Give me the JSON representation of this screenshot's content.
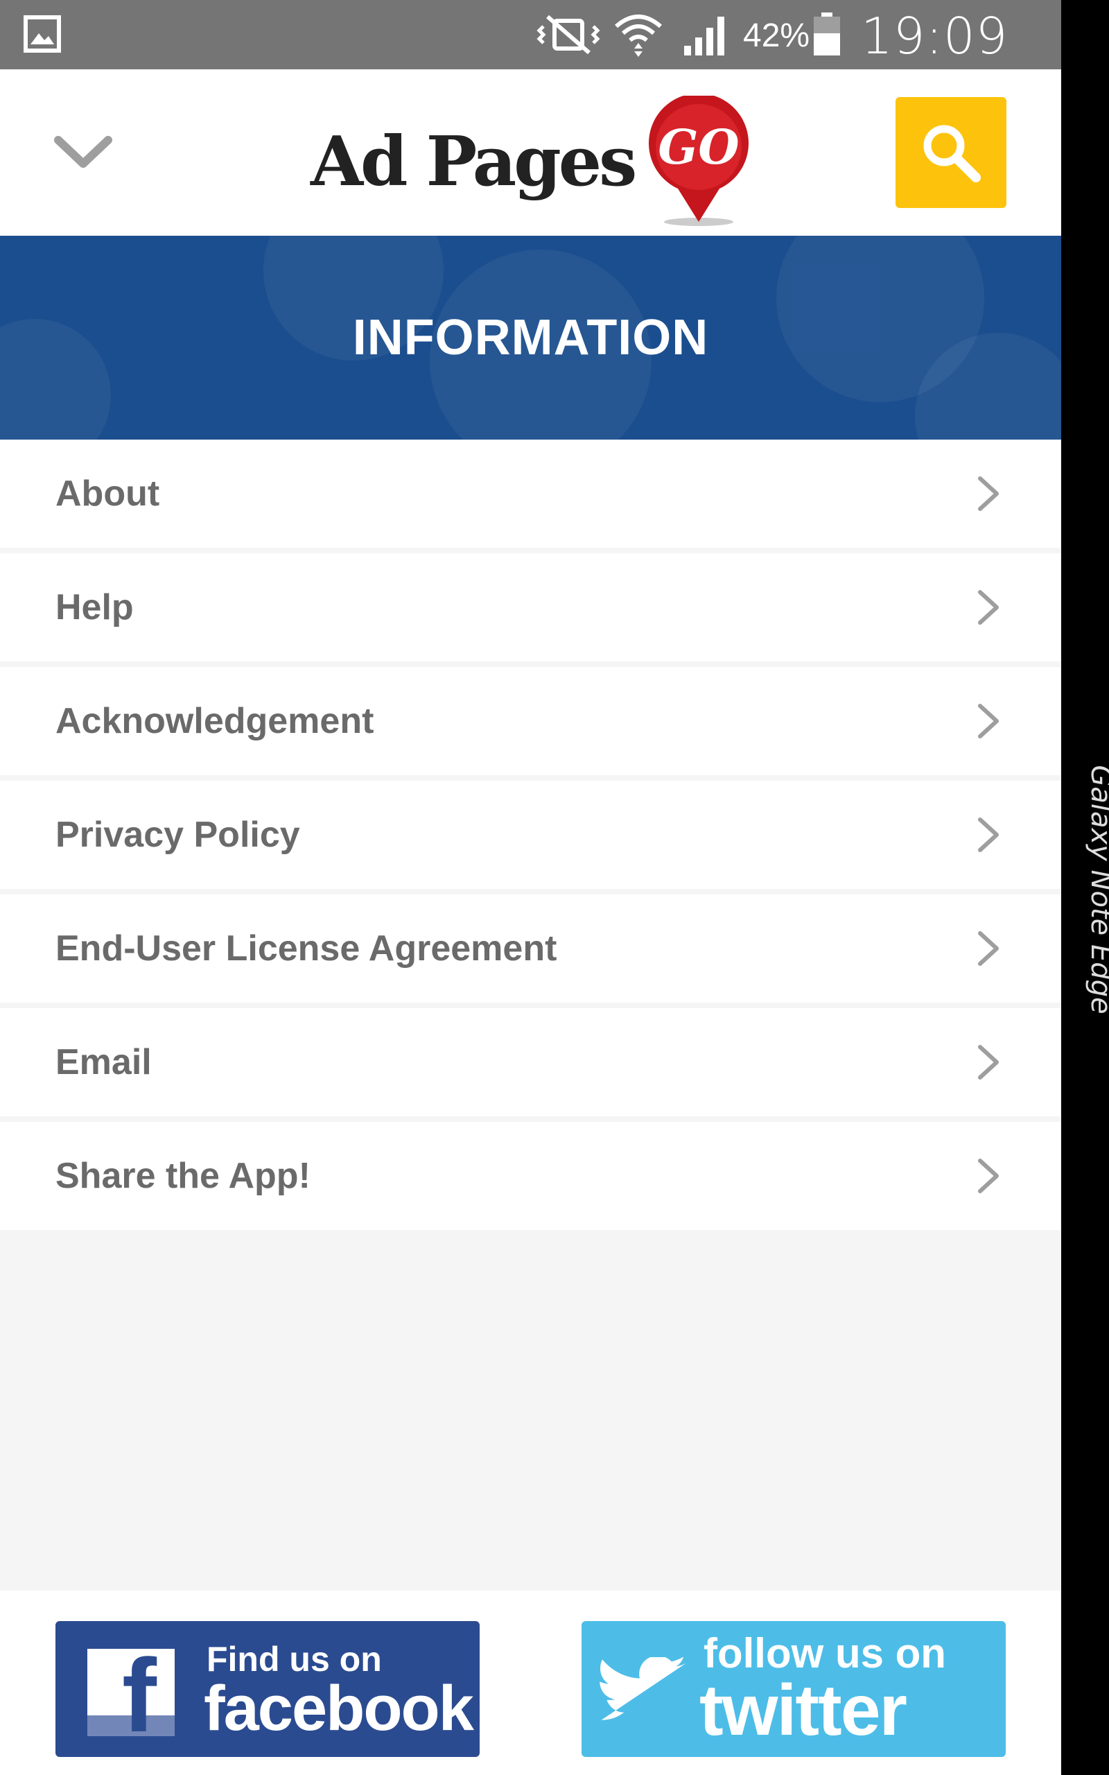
{
  "status_bar": {
    "battery_percent": "42%",
    "time": "19:09",
    "icons": [
      "gallery-icon",
      "vibrate-mute-icon",
      "wifi-icon",
      "signal-icon",
      "battery-icon"
    ]
  },
  "header": {
    "logo_text": "Ad Pages",
    "logo_badge": "GO",
    "icons": [
      "chevron-down-icon",
      "search-icon"
    ]
  },
  "banner": {
    "title": "INFORMATION"
  },
  "menu": {
    "items": [
      {
        "label": "About"
      },
      {
        "label": "Help"
      },
      {
        "label": "Acknowledgement"
      },
      {
        "label": "Privacy Policy"
      },
      {
        "label": "End-User License Agreement"
      },
      {
        "label": "Email"
      },
      {
        "label": "Share the App!"
      }
    ]
  },
  "footer": {
    "facebook": {
      "line1": "Find us on",
      "line2": "facebook",
      "icon_letter": "f"
    },
    "twitter": {
      "line1": "follow us on",
      "line2": "twitter"
    }
  },
  "edge_panel": {
    "label": "Galaxy Note Edge"
  },
  "colors": {
    "status_bar": "#757575",
    "banner": "#1b4e8e",
    "search_button": "#fdc30c",
    "menu_text": "#6a6a6a",
    "facebook": "#2b4b91",
    "twitter": "#4dbde8"
  }
}
